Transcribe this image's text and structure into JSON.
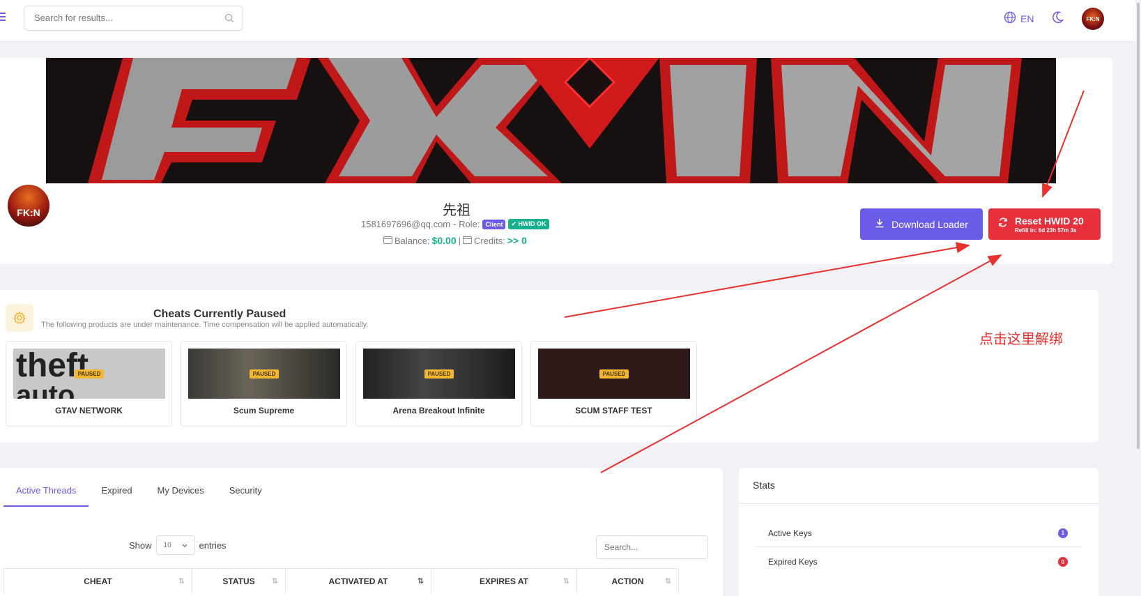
{
  "header": {
    "search_placeholder": "Search for results...",
    "language": "EN",
    "avatar_label": "FK:N"
  },
  "profile": {
    "name": "先祖",
    "email": "1581697696@qq.com",
    "role_label": "- Role:",
    "role_badge": "Client",
    "hwid_badge": "HWID OK",
    "balance_label": "Balance:",
    "balance_value": "$0.00",
    "separator": "|",
    "credits_label": "Credits:",
    "credits_value": ">> 0",
    "avatar_text": "FK:N"
  },
  "actions": {
    "download_label": "Download Loader",
    "reset_label": "Reset HWID 20",
    "reset_refill": "Refill in: 6d 23h 57m 3s"
  },
  "paused": {
    "title": "Cheats Currently Paused",
    "subtitle": "The following products are under maintenance. Time compensation will be applied automatically.",
    "products": [
      {
        "name": "GTAV NETWORK",
        "tag": "PAUSED"
      },
      {
        "name": "Scum Supreme",
        "tag": "PAUSED"
      },
      {
        "name": "Arena Breakout Infinite",
        "tag": "PAUSED"
      },
      {
        "name": "SCUM STAFF TEST",
        "tag": "PAUSED"
      }
    ]
  },
  "threads": {
    "tabs": [
      "Active Threads",
      "Expired",
      "My Devices",
      "Security"
    ],
    "show_label": "Show",
    "entries_value": "10",
    "entries_label": "entries",
    "search_placeholder": "Search...",
    "columns": [
      "CHEAT",
      "STATUS",
      "ACTIVATED AT",
      "EXPIRES AT",
      "ACTION"
    ]
  },
  "stats": {
    "title": "Stats",
    "rows": [
      {
        "label": "Active Keys",
        "count": "1",
        "color": "#6b5ce7"
      },
      {
        "label": "Expired Keys",
        "count": "0",
        "color": "#e8303c"
      }
    ]
  },
  "annotation": {
    "text": "点击这里解绑",
    "color": "#e8302c"
  }
}
